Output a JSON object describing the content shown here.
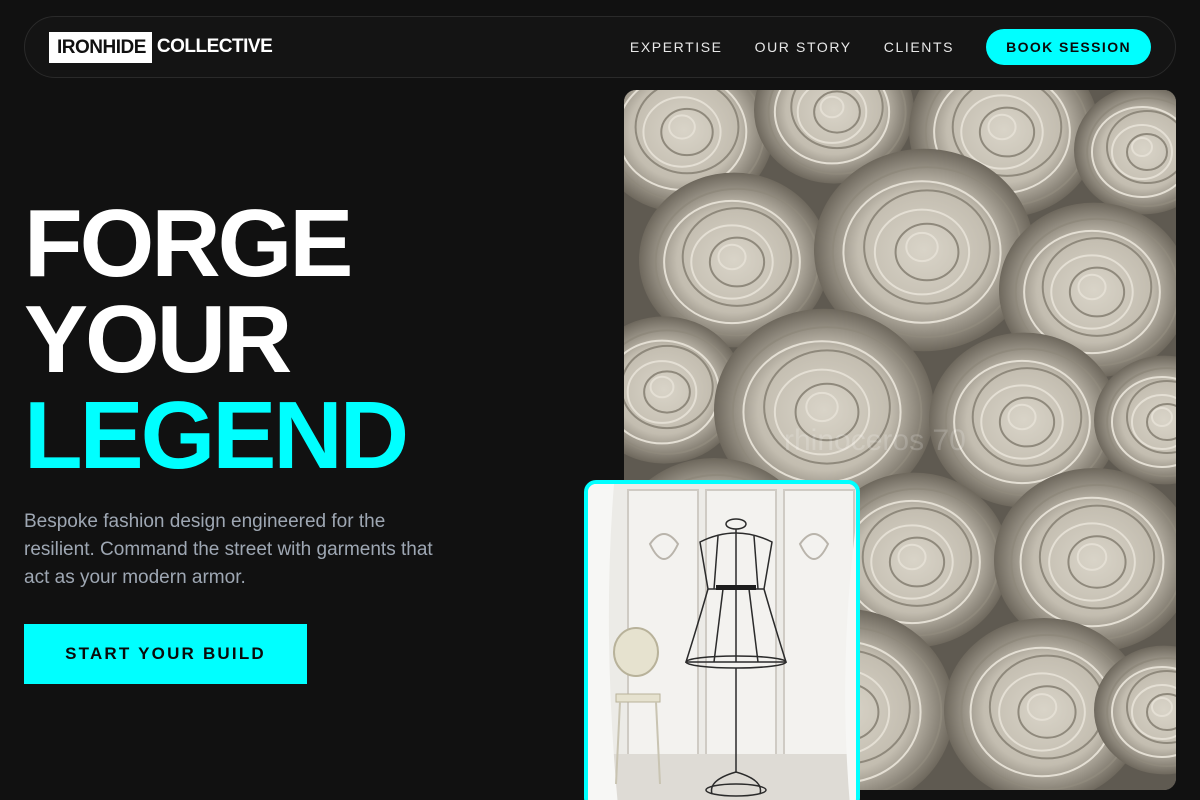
{
  "brand": {
    "logo_box_text": "IRONHIDE",
    "logo_word": "COLLECTIVE"
  },
  "nav": {
    "items": [
      {
        "label": "EXPERTISE"
      },
      {
        "label": "OUR STORY"
      },
      {
        "label": "CLIENTS"
      }
    ],
    "cta_label": "BOOK SESSION"
  },
  "hero": {
    "title_line1": "FORGE",
    "title_line2": "YOUR",
    "title_line3": "LEGEND",
    "description": "Bespoke fashion design engineered for the resilient. Command the street with garments that act as your modern armor.",
    "cta_label": "START YOUR BUILD"
  },
  "media": {
    "main_image_watermark": "rhinoceros 70",
    "main_image_subject": "rolled-fabric-bolts",
    "secondary_image_subject": "dress-form-mannequin"
  },
  "colors": {
    "accent": "#00ffff",
    "background": "#111111",
    "text_primary": "#ffffff",
    "text_muted": "#9ea7b3"
  }
}
